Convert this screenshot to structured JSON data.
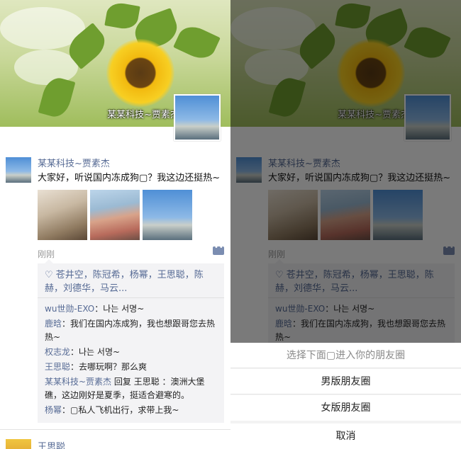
{
  "cover": {
    "name": "某某科技~贾素杰"
  },
  "post": {
    "author": "某某科技~贾素杰",
    "text": "大家好，听说国内冻成狗▢？我这边还挺热~",
    "time": "刚刚",
    "likes": "♡ 苍井空，陈冠希，杨幂，王思聪，陈赫，刘德华，马云...",
    "comments": [
      {
        "who": "wu世勋-EXO",
        "text": "：나는 서명~"
      },
      {
        "who": "鹿晗",
        "text": "：我们在国内冻成狗，我也想跟哥您去热热~"
      },
      {
        "who": "权志龙",
        "text": "：나는 서명~"
      },
      {
        "who": "王思聪",
        "text": "：去哪玩啊？那么爽"
      },
      {
        "who": "某某科技~贾素杰",
        "text": " 回复 王思聪 ：澳洲大堡礁，这边刚好是夏季，挺适合避寒的。"
      },
      {
        "who": "杨幂",
        "text": "：▢私人飞机出行，求带上我~"
      }
    ]
  },
  "next_post": {
    "author": "王思聪"
  },
  "sheet": {
    "title": "选择下面▢进入你的朋友圈",
    "option1": "男版朋友圈",
    "option2": "女版朋友圈",
    "cancel": "取消"
  }
}
